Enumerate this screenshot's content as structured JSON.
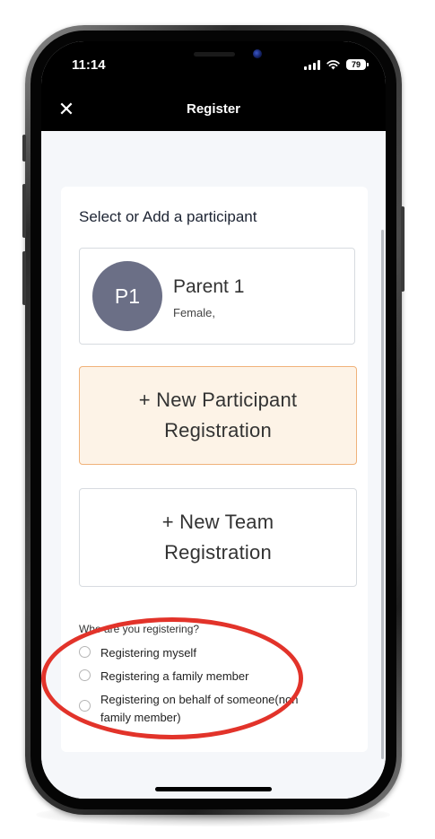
{
  "status_bar": {
    "time": "11:14",
    "battery": "79"
  },
  "header": {
    "close_label": "✕",
    "title": "Register"
  },
  "scroll": {
    "cut_off_text": ""
  },
  "card": {
    "title": "Select or Add a participant",
    "participant": {
      "initials": "P1",
      "name": "Parent 1",
      "details": "Female,"
    },
    "new_participant_button": {
      "line1": "+ New Participant",
      "line2": "Registration"
    },
    "new_team_button": {
      "line1": "+ New Team",
      "line2": "Registration"
    },
    "question": "Who are you registering?",
    "options": [
      {
        "label": "Registering myself"
      },
      {
        "label": "Registering a family member"
      },
      {
        "label": "Registering on behalf of someone(non family member)"
      }
    ]
  },
  "colors": {
    "header_bg": "#000000",
    "page_bg": "#f5f7fa",
    "avatar_bg": "#6b6f86",
    "new_participant_bg": "#fdf3e7",
    "new_participant_border": "#f0b27a",
    "annotation": "#e2332a"
  },
  "icons": [
    "close-icon",
    "signal-icon",
    "wifi-icon",
    "battery-icon",
    "radio-button"
  ]
}
